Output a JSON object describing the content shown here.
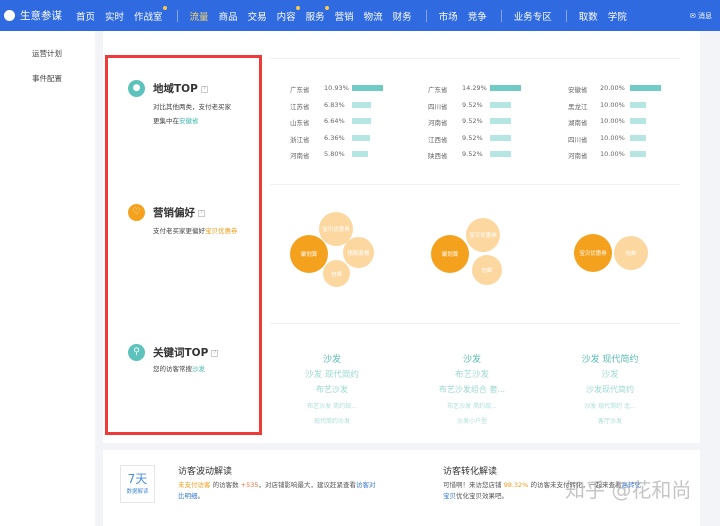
{
  "nav": {
    "brand": "生意参谋",
    "items": [
      {
        "label": "首页"
      },
      {
        "label": "实时"
      },
      {
        "label": "作战室",
        "dot": true
      },
      {
        "label": "流量",
        "active": true
      },
      {
        "label": "商品"
      },
      {
        "label": "交易"
      },
      {
        "label": "内容",
        "dot": true
      },
      {
        "label": "服务",
        "dot": true
      },
      {
        "label": "营销"
      },
      {
        "label": "物流"
      },
      {
        "label": "财务"
      },
      {
        "label": "市场"
      },
      {
        "label": "竞争"
      },
      {
        "label": "业务专区"
      },
      {
        "label": "取数"
      },
      {
        "label": "学院"
      }
    ],
    "message": "消息"
  },
  "sidebar": {
    "items": [
      "运营计划",
      "事件配置"
    ]
  },
  "region": {
    "title": "地域TOP",
    "desc": "对比其他两类，支付老买家",
    "desc2": "更集中在",
    "highlight": "安徽省",
    "columns": [
      [
        {
          "name": "广东省",
          "pct": "10.93%",
          "v": 10.93
        },
        {
          "name": "江苏省",
          "pct": "6.83%",
          "v": 6.83
        },
        {
          "name": "山东省",
          "pct": "6.64%",
          "v": 6.64
        },
        {
          "name": "浙江省",
          "pct": "6.36%",
          "v": 6.36
        },
        {
          "name": "河南省",
          "pct": "5.80%",
          "v": 5.8
        }
      ],
      [
        {
          "name": "广东省",
          "pct": "14.29%",
          "v": 14.29
        },
        {
          "name": "四川省",
          "pct": "9.52%",
          "v": 9.52
        },
        {
          "name": "河南省",
          "pct": "9.52%",
          "v": 9.52
        },
        {
          "name": "江西省",
          "pct": "9.52%",
          "v": 9.52
        },
        {
          "name": "陕西省",
          "pct": "9.52%",
          "v": 9.52
        }
      ],
      [
        {
          "name": "安徽省",
          "pct": "20.00%",
          "v": 20
        },
        {
          "name": "黑龙江",
          "pct": "10.00%",
          "v": 10
        },
        {
          "name": "湖南省",
          "pct": "10.00%",
          "v": 10
        },
        {
          "name": "四川省",
          "pct": "10.00%",
          "v": 10
        },
        {
          "name": "河南省",
          "pct": "10.00%",
          "v": 10
        }
      ]
    ]
  },
  "marketing": {
    "title": "营销偏好",
    "desc": "支付老买家更偏好",
    "highlight": "宝贝优惠券",
    "groups": [
      [
        "聚划算",
        "宝贝优惠券",
        "搭配套餐",
        "包邮"
      ],
      [
        "聚划算",
        "宝贝优惠券",
        "包邮"
      ],
      [
        "宝贝优惠券",
        "包邮"
      ]
    ]
  },
  "keywords": {
    "title": "关键词TOP",
    "desc": "您的访客常搜",
    "highlight": "沙发",
    "columns": [
      [
        "沙发",
        "沙发 现代简约",
        "布艺沙发",
        "布艺沙发 简约现...",
        "现代简约沙发"
      ],
      [
        "沙发",
        "布艺沙发",
        "布艺沙发组合 套...",
        "布艺沙发 简约现...",
        "沙发小户型"
      ],
      [
        "沙发 现代简约",
        "沙发",
        "沙发现代简约",
        "沙发 现代简约 北...",
        "客厅沙发"
      ]
    ]
  },
  "insight": {
    "badge_big": "7天",
    "badge_small": "数据解读",
    "left": {
      "title": "访客波动解读",
      "t1": "未支付访客",
      "t2": " 的访客数 ",
      "t3": "+535",
      "t4": "，对店铺影响最大，建议赶紧查看",
      "t5": "访客对比明细",
      "t6": "。"
    },
    "right": {
      "title": "访客转化解读",
      "t1": "可惜啊！来访您店铺 ",
      "t2": "98.32%",
      "t3": " 的访客未支付转化，一起来查看",
      "t4": "高转化宝贝",
      "t5": "优化宝贝效果吧。"
    },
    "watermark": "知乎 @花和尚"
  }
}
